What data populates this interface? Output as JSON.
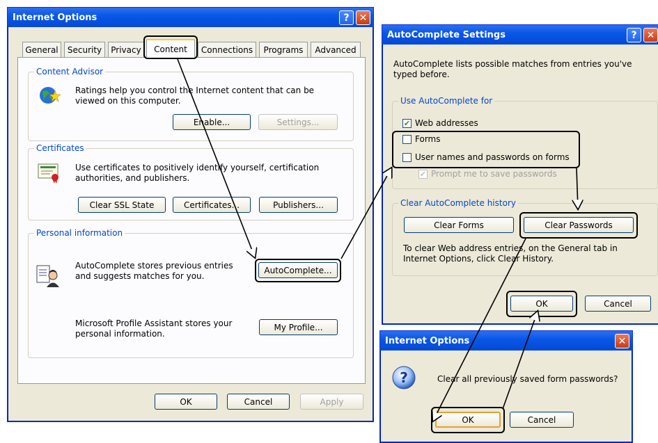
{
  "internet_options": {
    "title": "Internet Options",
    "tabs": [
      "General",
      "Security",
      "Privacy",
      "Content",
      "Connections",
      "Programs",
      "Advanced"
    ],
    "content_advisor": {
      "label": "Content Advisor",
      "text": "Ratings help you control the Internet content that can be viewed on this computer.",
      "enable": "Enable...",
      "settings": "Settings..."
    },
    "certificates": {
      "label": "Certificates",
      "text": "Use certificates to positively identify yourself, certification authorities, and publishers.",
      "clear_ssl": "Clear SSL State",
      "certs": "Certificates...",
      "publishers": "Publishers..."
    },
    "personal": {
      "label": "Personal information",
      "autocomplete_text": "AutoComplete stores previous entries and suggests matches for you.",
      "autocomplete_btn": "AutoComplete...",
      "profile_text": "Microsoft Profile Assistant stores your personal information.",
      "profile_btn": "My Profile..."
    },
    "ok": "OK",
    "cancel": "Cancel",
    "apply": "Apply"
  },
  "autocomplete": {
    "title": "AutoComplete Settings",
    "intro": "AutoComplete lists possible matches from entries you've typed before.",
    "use_label": "Use AutoComplete for",
    "web_addresses": "Web addresses",
    "forms": "Forms",
    "usernames": "User names and passwords on forms",
    "prompt": "Prompt me to save passwords",
    "clear_label": "Clear AutoComplete history",
    "clear_forms": "Clear Forms",
    "clear_passwords": "Clear Passwords",
    "clear_note": "To clear Web address entries, on the General tab in Internet Options, click Clear History.",
    "ok": "OK",
    "cancel": "Cancel"
  },
  "confirm": {
    "title": "Internet Options",
    "message": "Clear all previously saved form passwords?",
    "ok": "OK",
    "cancel": "Cancel"
  },
  "title_buttons": {
    "help": "?",
    "close": "✕"
  }
}
